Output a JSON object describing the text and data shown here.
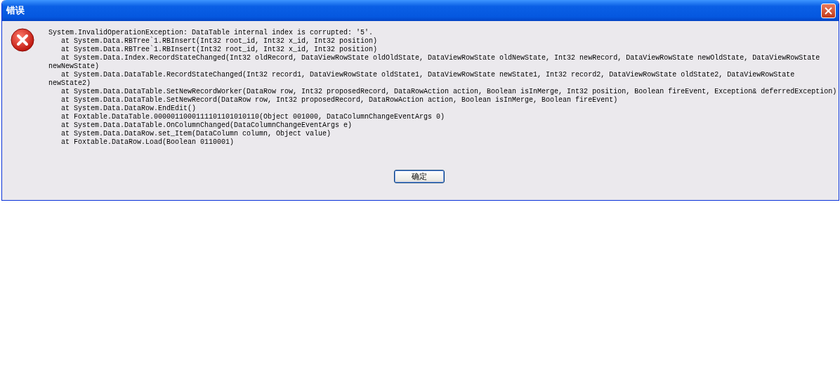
{
  "window": {
    "title": "错误"
  },
  "message_lines": [
    "System.InvalidOperationException: DataTable internal index is corrupted: '5'.",
    "   at System.Data.RBTree`1.RBInsert(Int32 root_id, Int32 x_id, Int32 position)",
    "   at System.Data.RBTree`1.RBInsert(Int32 root_id, Int32 x_id, Int32 position)",
    "   at System.Data.Index.RecordStateChanged(Int32 oldRecord, DataViewRowState oldOldState, DataViewRowState oldNewState, Int32 newRecord, DataViewRowState newOldState, DataViewRowState",
    "newNewState)",
    "   at System.Data.DataTable.RecordStateChanged(Int32 record1, DataViewRowState oldState1, DataViewRowState newState1, Int32 record2, DataViewRowState oldState2, DataViewRowState",
    "newState2)",
    "   at System.Data.DataTable.SetNewRecordWorker(DataRow row, Int32 proposedRecord, DataRowAction action, Boolean isInMerge, Int32 position, Boolean fireEvent, Exception& deferredException)",
    "   at System.Data.DataTable.SetNewRecord(DataRow row, Int32 proposedRecord, DataRowAction action, Boolean isInMerge, Boolean fireEvent)",
    "   at System.Data.DataRow.EndEdit()",
    "   at Foxtable.DataTable.0000011000111101101010110(Object 001000, DataColumnChangeEventArgs 0)",
    "   at System.Data.DataTable.OnColumnChanged(DataColumnChangeEventArgs e)",
    "   at System.Data.DataRow.set_Item(DataColumn column, Object value)",
    "   at Foxtable.DataRow.Load(Boolean 0110001)"
  ],
  "buttons": [
    {
      "label": "确定"
    }
  ]
}
